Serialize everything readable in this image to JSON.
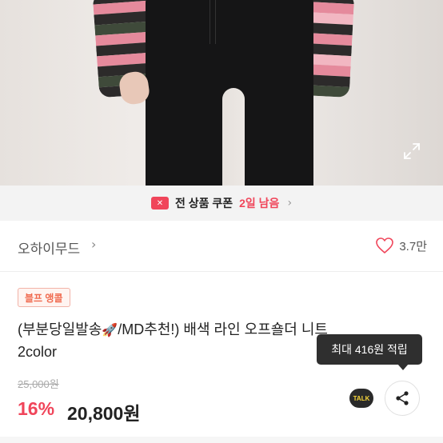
{
  "photo": {
    "expand_icon": "expand-icon"
  },
  "coupon": {
    "icon_text": "✕",
    "label": "전 상품 쿠폰",
    "remaining": "2일 남음",
    "chevron": "›"
  },
  "shop": {
    "name": "오하이무드",
    "chevron": "›",
    "like_count": "3.7만",
    "accent": "#f0455a"
  },
  "product": {
    "badge": "블프 앵콜",
    "title_line1_a": "(부분당일발송",
    "title_emoji": "🚀",
    "title_line1_b": "/MD추천!) 배색 라인 오프숄더 니트",
    "title_line2": "2color",
    "original_price": "25,000원",
    "discount": "16%",
    "price": "20,800원"
  },
  "tooltip": {
    "text": "최대 416원 적립"
  },
  "actions": {
    "talk_label": "TALK",
    "share_icon": "share-icon"
  }
}
